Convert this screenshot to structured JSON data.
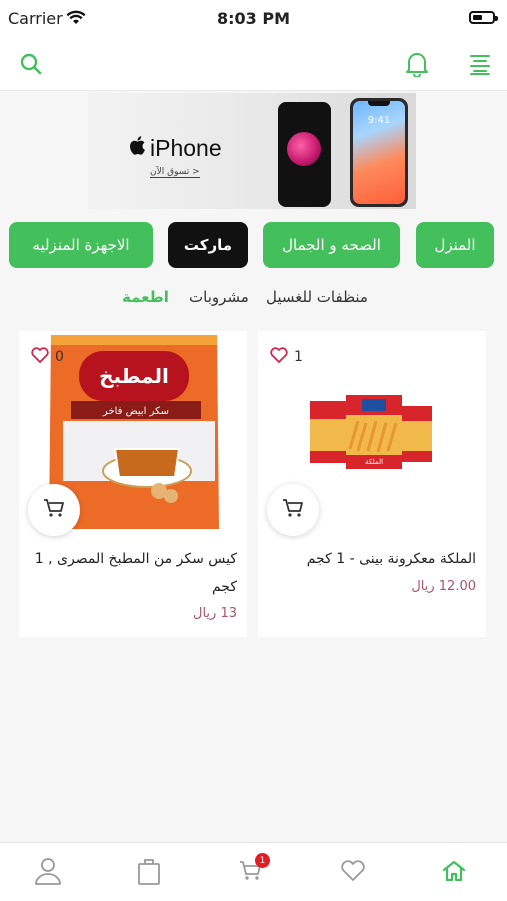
{
  "status": {
    "carrier": "Carrier",
    "time": "8:03 PM"
  },
  "banner": {
    "title": "iPhone",
    "subtitle": "تسوق الآن >",
    "phone_clock": "9:41"
  },
  "categories": [
    {
      "label": "المنزل"
    },
    {
      "label": "الصحه و الجمال"
    },
    {
      "label": "ماركت"
    },
    {
      "label": "الاجهزة المنزليه"
    }
  ],
  "subcategories": [
    {
      "label": "منظفات للغسيل"
    },
    {
      "label": "مشروبات"
    },
    {
      "label": "اطعمة"
    }
  ],
  "products": [
    {
      "name": "الملكة معكرونة بينى - 1 كجم",
      "price": "12.00 ريال",
      "likes": "1",
      "pack_brand": "الملكة"
    },
    {
      "name": "كيس سكر من المطبخ المصرى , 1 كجم",
      "price": "13 ريال",
      "likes": "0",
      "pack_brand": "المطبخ",
      "pack_line": "سكر ابيض فاخر"
    }
  ],
  "tabbar": {
    "cart_badge": "1"
  },
  "colors": {
    "accent": "#43bf5b",
    "price": "#a8556b",
    "badge": "#e31b23"
  }
}
